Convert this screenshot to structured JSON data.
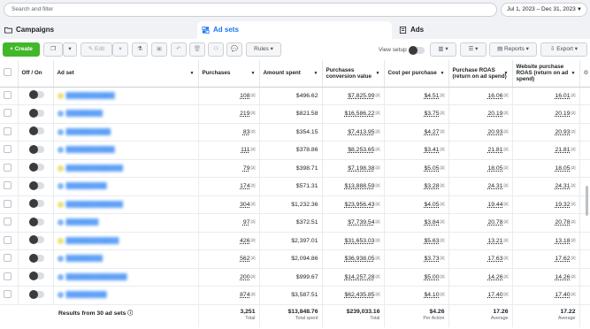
{
  "search": {
    "placeholder": "Search and filter"
  },
  "date_range": "Jul 1, 2023 – Dec 31, 2023",
  "tabs": [
    {
      "label": "Campaigns",
      "icon": "folder-icon"
    },
    {
      "label": "Ad sets",
      "icon": "grid-icon"
    },
    {
      "label": "Ads",
      "icon": "document-icon"
    }
  ],
  "toolbar": {
    "create_label": "Create",
    "edit_label": "Edit",
    "rules_label": "Rules",
    "view_setup_label": "View setup",
    "reports_label": "Reports",
    "export_label": "Export"
  },
  "table": {
    "headers": {
      "off_on": "Off / On",
      "ad_set": "Ad set",
      "purchases": "Purchases",
      "amount_spent": "Amount spent",
      "conv_value": "Purchases conversion value",
      "cpp": "Cost per purchase",
      "roas": "Purchase ROAS (return on ad spend)",
      "web_roas": "Website purchase ROAS (return on ad spend)"
    },
    "rows": [
      {
        "dot": "yellow",
        "purchases": "108",
        "spent": "$496.62",
        "value": "$7,825.99",
        "cpp": "$4.51",
        "roas": "16.06",
        "web_roas": "16.01"
      },
      {
        "dot": "blue",
        "purchases": "219",
        "spent": "$821.58",
        "value": "$16,586.22",
        "cpp": "$3.75",
        "roas": "20.19",
        "web_roas": "20.19"
      },
      {
        "dot": "blue",
        "purchases": "83",
        "spent": "$354.15",
        "value": "$7,413.95",
        "cpp": "$4.27",
        "roas": "20.93",
        "web_roas": "20.93"
      },
      {
        "dot": "blue",
        "purchases": "111",
        "spent": "$378.86",
        "value": "$8,253.65",
        "cpp": "$3.41",
        "roas": "21.81",
        "web_roas": "21.81"
      },
      {
        "dot": "yellow",
        "purchases": "79",
        "spent": "$398.71",
        "value": "$7,198.38",
        "cpp": "$5.05",
        "roas": "18.05",
        "web_roas": "18.05"
      },
      {
        "dot": "blue",
        "purchases": "174",
        "spent": "$571.31",
        "value": "$13,888.59",
        "cpp": "$3.28",
        "roas": "24.31",
        "web_roas": "24.31"
      },
      {
        "dot": "yellow",
        "purchases": "304",
        "spent": "$1,232.36",
        "value": "$23,956.43",
        "cpp": "$4.05",
        "roas": "19.44",
        "web_roas": "19.32"
      },
      {
        "dot": "blue",
        "purchases": "97",
        "spent": "$372.51",
        "value": "$7,739.54",
        "cpp": "$3.84",
        "roas": "20.78",
        "web_roas": "20.78"
      },
      {
        "dot": "yellow",
        "purchases": "426",
        "spent": "$2,397.01",
        "value": "$31,653.03",
        "cpp": "$5.63",
        "roas": "13.21",
        "web_roas": "13.18"
      },
      {
        "dot": "blue",
        "purchases": "562",
        "spent": "$2,094.86",
        "value": "$36,938.05",
        "cpp": "$3.73",
        "roas": "17.63",
        "web_roas": "17.62"
      },
      {
        "dot": "blue",
        "purchases": "200",
        "spent": "$999.67",
        "value": "$14,257.28",
        "cpp": "$5.00",
        "roas": "14.26",
        "web_roas": "14.26"
      },
      {
        "dot": "blue",
        "purchases": "874",
        "spent": "$3,587.51",
        "value": "$62,435.85",
        "cpp": "$4.10",
        "roas": "17.40",
        "web_roas": "17.40"
      }
    ],
    "footer": {
      "results_label": "Results from 30 ad sets",
      "purchases": "3,251",
      "purchases_label": "Total",
      "spent": "$13,848.76",
      "spent_label": "Total spent",
      "value": "$239,033.16",
      "value_label": "Total",
      "cpp": "$4.26",
      "cpp_label": "Per Action",
      "roas": "17.26",
      "roas_label": "Average",
      "web_roas": "17.22",
      "web_roas_label": "Average"
    }
  }
}
